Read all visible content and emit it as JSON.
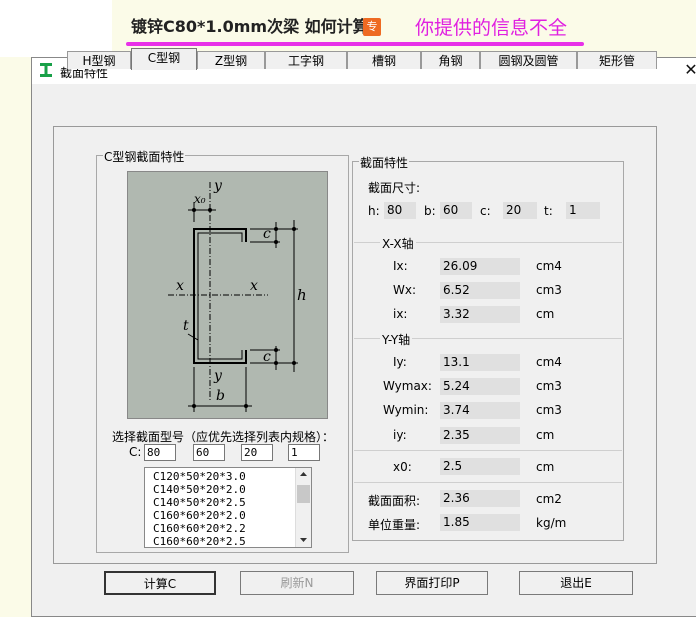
{
  "banner": {
    "question_title": "镀锌C80*1.0mm次梁 如何计算",
    "badge": "专",
    "answer": "你提供的信息不全"
  },
  "dialog": {
    "title": "截面特性",
    "close_glyph": "✕",
    "app_icon": "i-beam-icon"
  },
  "tabs": [
    {
      "label": "H型钢",
      "active": false
    },
    {
      "label": "C型钢",
      "active": true
    },
    {
      "label": "Z型钢",
      "active": false
    },
    {
      "label": "工字钢",
      "active": false
    },
    {
      "label": "槽钢",
      "active": false
    },
    {
      "label": "角钢",
      "active": false
    },
    {
      "label": "圆钢及圆管",
      "active": false
    },
    {
      "label": "矩形管",
      "active": false
    }
  ],
  "left_group": {
    "label": "C型钢截面特性",
    "diagram_labels": {
      "y_top": "y",
      "x0": "x₀",
      "c_top": "c",
      "x_left": "x",
      "x_right": "x",
      "h": "h",
      "t": "t",
      "c_bottom": "c",
      "y_bottom": "y",
      "b": "b"
    },
    "select_prompt": "选择截面型号（应优先选择列表内规格）：",
    "c_label": "C:",
    "inputs": [
      "80",
      "60",
      "20",
      "1"
    ],
    "list_items": [
      "C120*50*20*3.0",
      "C140*50*20*2.0",
      "C140*50*20*2.5",
      "C160*60*20*2.0",
      "C160*60*20*2.2",
      "C160*60*20*2.5"
    ]
  },
  "right_group": {
    "label": "截面特性",
    "dims_title": "截面尺寸:",
    "dims": [
      {
        "label": "h:",
        "value": "80"
      },
      {
        "label": "b:",
        "value": "60"
      },
      {
        "label": "c:",
        "value": "20"
      },
      {
        "label": "t:",
        "value": "1"
      }
    ],
    "xx_title": "X-X轴",
    "xx": [
      {
        "label": "Ix:",
        "value": "26.09",
        "unit": "cm4"
      },
      {
        "label": "Wx:",
        "value": "6.52",
        "unit": "cm3"
      },
      {
        "label": "ix:",
        "value": "3.32",
        "unit": "cm"
      }
    ],
    "yy_title": "Y-Y轴",
    "yy": [
      {
        "label": "Iy:",
        "value": "13.1",
        "unit": "cm4"
      },
      {
        "label": "Wymax:",
        "value": "5.24",
        "unit": "cm3"
      },
      {
        "label": "Wymin:",
        "value": "3.74",
        "unit": "cm3"
      },
      {
        "label": "iy:",
        "value": "2.35",
        "unit": "cm"
      }
    ],
    "x0": {
      "label": "x0:",
      "value": "2.5",
      "unit": "cm"
    },
    "area": {
      "label": "截面面积:",
      "value": "2.36",
      "unit": "cm2"
    },
    "weight": {
      "label": "单位重量:",
      "value": "1.85",
      "unit": "kg/m"
    }
  },
  "buttons": [
    {
      "label": "计算C",
      "state": "default"
    },
    {
      "label": "刷新N",
      "state": "disabled"
    },
    {
      "label": "界面打印P",
      "state": "normal"
    },
    {
      "label": "退出E",
      "state": "normal"
    }
  ]
}
